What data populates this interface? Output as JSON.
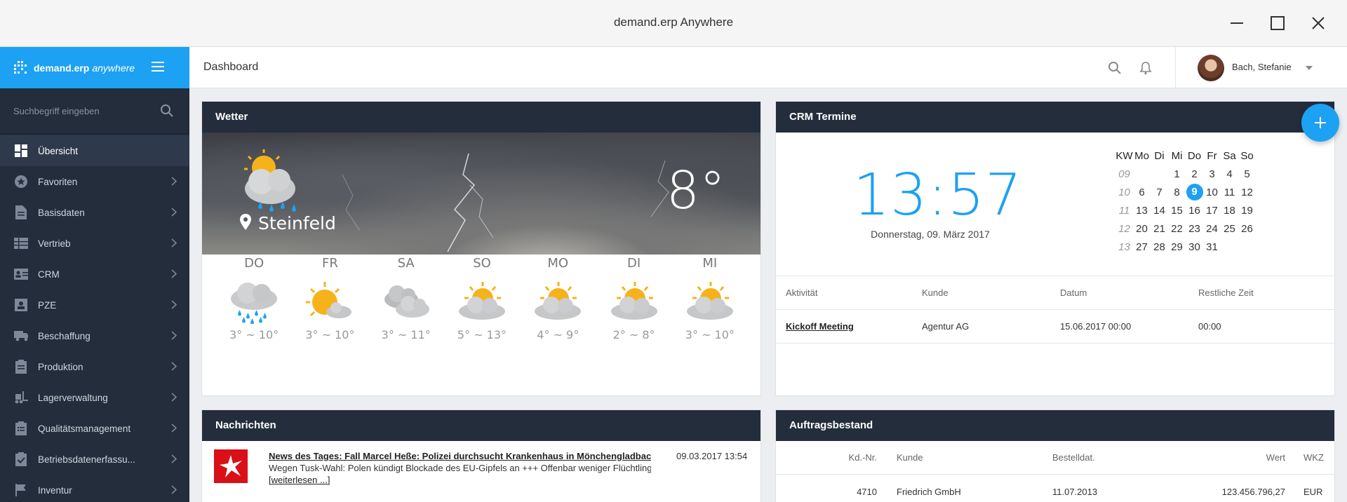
{
  "window": {
    "title": "demand.erp Anywhere"
  },
  "brand": {
    "name": "demand.erp",
    "suffix": "anywhere"
  },
  "sidebar": {
    "search_placeholder": "Suchbegriff eingeben",
    "items": [
      {
        "label": "Übersicht",
        "icon": "dashboard-icon",
        "active": true
      },
      {
        "label": "Favoriten",
        "icon": "star-icon"
      },
      {
        "label": "Basisdaten",
        "icon": "document-icon"
      },
      {
        "label": "Vertrieb",
        "icon": "table-icon"
      },
      {
        "label": "CRM",
        "icon": "contact-card-icon"
      },
      {
        "label": "PZE",
        "icon": "person-badge-icon"
      },
      {
        "label": "Beschaffung",
        "icon": "truck-icon"
      },
      {
        "label": "Produktion",
        "icon": "clipboard-icon"
      },
      {
        "label": "Lagerverwaltung",
        "icon": "forklift-icon"
      },
      {
        "label": "Qualitätsmanagement",
        "icon": "clipboard-list-icon"
      },
      {
        "label": "Betriebsdatenerfassu...",
        "icon": "clipboard-check-icon"
      },
      {
        "label": "Inventur",
        "icon": "flag-icon"
      }
    ]
  },
  "header": {
    "title": "Dashboard",
    "user": "Bach, Stefanie"
  },
  "weather": {
    "title": "Wetter",
    "city": "Steinfeld",
    "temperature": "8°",
    "days": [
      {
        "name": "DO",
        "range": "3° ~ 10°",
        "icon": "rain-cloud-icon"
      },
      {
        "name": "FR",
        "range": "3° ~ 10°",
        "icon": "sun-small-cloud-icon"
      },
      {
        "name": "SA",
        "range": "3° ~ 11°",
        "icon": "clouds-icon"
      },
      {
        "name": "SO",
        "range": "5° ~ 13°",
        "icon": "sun-cloud-icon"
      },
      {
        "name": "MO",
        "range": "4° ~ 9°",
        "icon": "sun-cloud-icon"
      },
      {
        "name": "DI",
        "range": "2° ~ 8°",
        "icon": "sun-cloud-icon"
      },
      {
        "name": "MI",
        "range": "3° ~ 10°",
        "icon": "sun-cloud-icon"
      }
    ]
  },
  "crm": {
    "title": "CRM Termine",
    "time": "13:57",
    "date": "Donnerstag, 09. März 2017",
    "calendar": {
      "headers": [
        "KW",
        "Mo",
        "Di",
        "Mi",
        "Do",
        "Fr",
        "Sa",
        "So"
      ],
      "rows": [
        [
          "09",
          "",
          "",
          "1",
          "2",
          "3",
          "4",
          "5"
        ],
        [
          "10",
          "6",
          "7",
          "8",
          "9",
          "10",
          "11",
          "12"
        ],
        [
          "11",
          "13",
          "14",
          "15",
          "16",
          "17",
          "18",
          "19"
        ],
        [
          "12",
          "20",
          "21",
          "22",
          "23",
          "24",
          "25",
          "26"
        ],
        [
          "13",
          "27",
          "28",
          "29",
          "30",
          "31",
          "",
          ""
        ]
      ],
      "today": "9"
    },
    "columns": [
      "Aktivität",
      "Kunde",
      "Datum",
      "Restliche Zeit"
    ],
    "rows": [
      {
        "activity": "Kickoff Meeting",
        "customer": "Agentur AG",
        "date": "15.06.2017 00:00",
        "remaining": "00:00"
      }
    ]
  },
  "news": {
    "title": "Nachrichten",
    "items": [
      {
        "headline": "News des Tages: Fall Marcel Heße: Polizei durchsucht Krankenhaus in Mönchengladbach",
        "text": "Wegen Tusk-Wahl: Polen kündigt Blockade des EU-Gipfels an +++ Offenbar weniger Flüchtlinge",
        "more": "[weiterlesen ...]",
        "date": "09.03.2017 13:54"
      }
    ]
  },
  "orders": {
    "title": "Auftragsbestand",
    "columns": [
      "Kd.-Nr.",
      "Kunde",
      "Bestelldat.",
      "Wert",
      "WKZ"
    ],
    "rows": [
      {
        "kdnr": "4710",
        "customer": "Friedrich GmbH",
        "date": "11.07.2013",
        "value": "123.456.796,27",
        "currency": "EUR"
      }
    ]
  },
  "colors": {
    "accent": "#1da1f2",
    "sidebar": "#232d3c",
    "card_header": "#232d3c"
  }
}
